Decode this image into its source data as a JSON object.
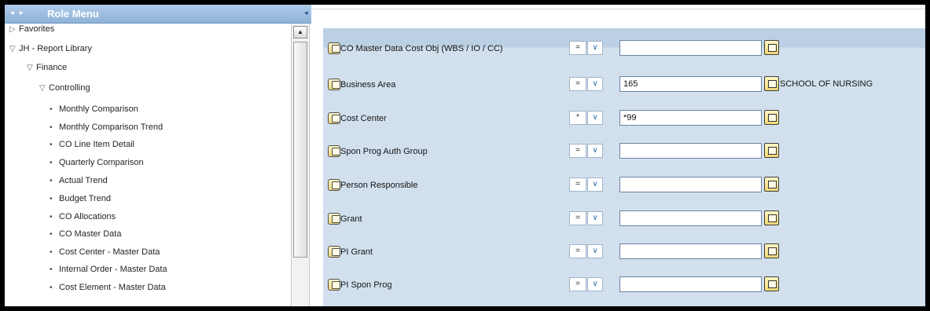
{
  "nav": {
    "title": "Role Menu",
    "prev_arrow": "◂",
    "next_arrow": "▸",
    "collapse_arrow": "◂",
    "tree": [
      {
        "label": "Favorites",
        "toggle": "▷",
        "kind": "folder"
      },
      {
        "label": "JH - Report Library",
        "toggle": "▽",
        "kind": "folder"
      },
      {
        "label": "Finance",
        "toggle": "▽",
        "kind": "folder"
      },
      {
        "label": "Controlling",
        "toggle": "▽",
        "kind": "folder"
      },
      {
        "label": "Monthly Comparison",
        "kind": "leaf"
      },
      {
        "label": "Monthly Comparison Trend",
        "kind": "leaf"
      },
      {
        "label": "CO Line Item Detail",
        "kind": "leaf"
      },
      {
        "label": "Quarterly Comparison",
        "kind": "leaf"
      },
      {
        "label": "Actual Trend",
        "kind": "leaf"
      },
      {
        "label": "Budget Trend",
        "kind": "leaf"
      },
      {
        "label": "CO Allocations",
        "kind": "leaf"
      },
      {
        "label": "CO Master Data",
        "kind": "leaf"
      },
      {
        "label": "Cost Center - Master Data",
        "kind": "leaf"
      },
      {
        "label": "Internal Order - Master Data",
        "kind": "leaf"
      },
      {
        "label": "Cost Element - Master Data",
        "kind": "leaf"
      }
    ],
    "bullet": "•",
    "scroll_up": "▲"
  },
  "form": {
    "fields": [
      {
        "label": "CO Master Data Cost Obj (WBS / IO / CC)",
        "operator": "=",
        "value": "",
        "description": ""
      },
      {
        "label": "Business Area",
        "operator": "=",
        "value": "165",
        "description": "SCHOOL OF NURSING"
      },
      {
        "label": "Cost Center",
        "operator": "*",
        "value": "*99",
        "description": ""
      },
      {
        "label": "Spon Prog Auth Group",
        "operator": "=",
        "value": "",
        "description": ""
      },
      {
        "label": "Person Responsible",
        "operator": "=",
        "value": "",
        "description": ""
      },
      {
        "label": "Grant",
        "operator": "=",
        "value": "",
        "description": ""
      },
      {
        "label": "PI Grant",
        "operator": "=",
        "value": "",
        "description": ""
      },
      {
        "label": "PI Spon Prog",
        "operator": "=",
        "value": "",
        "description": ""
      }
    ],
    "dropdown_glyph": "∨"
  },
  "colors": {
    "nav_header": "#9dbde0",
    "form_background": "#d2e0ee",
    "form_band": "#bcd0e4"
  }
}
